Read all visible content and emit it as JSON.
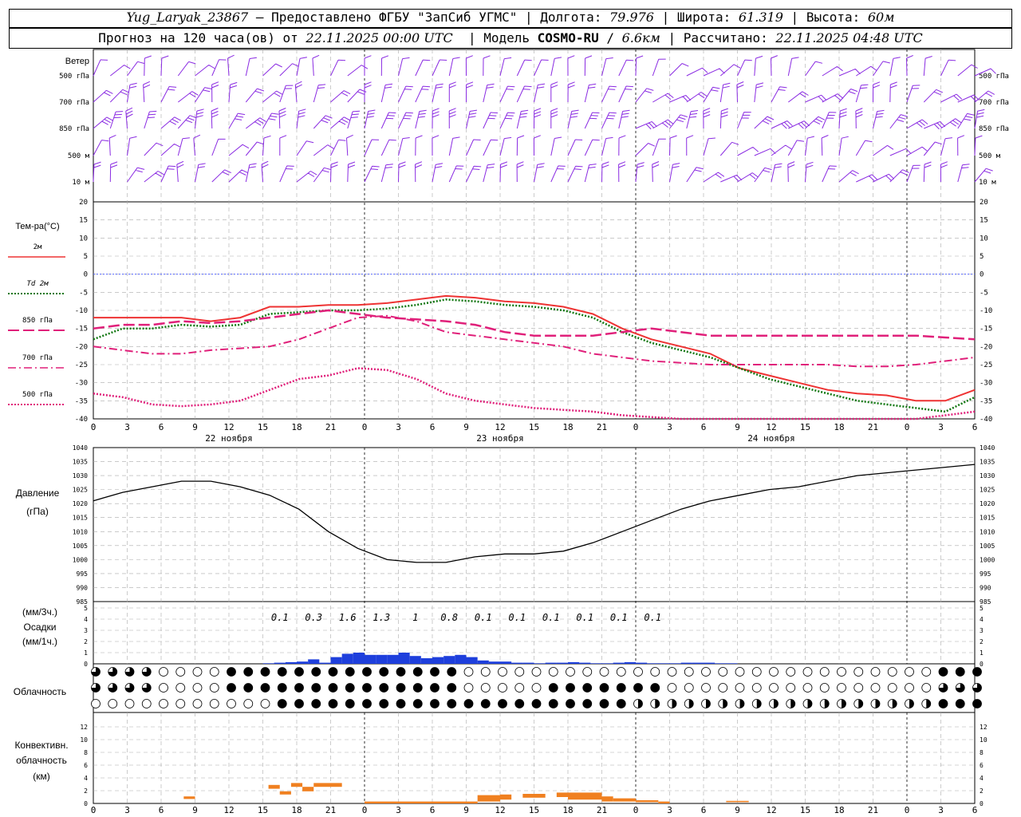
{
  "header": {
    "station": "Yug_Laryak_23867",
    "dash": " – ",
    "provider": "Предоставлено ФГБУ \"ЗапСиб УГМС\"",
    "lon_label": "Долгота: ",
    "lon_value": "79.976",
    "lat_label": "Широта: ",
    "lat_value": "61.319",
    "alt_label": "Высота: ",
    "alt_value": "60м",
    "forecast_label": "Прогноз на 120 часа(ов) от ",
    "forecast_time": "22.11.2025 00:00 UTC",
    "model_label": "Модель ",
    "model_name": "COSMO-RU",
    "model_res": "6.6км",
    "computed_label": "Рассчитано: ",
    "computed_time": "22.11.2025 04:48 UTC"
  },
  "colors": {
    "wind": "#8a2be2",
    "t2m": "#ee3333",
    "td2m": "#117711",
    "t850": "#e0207a",
    "t700": "#e0207a",
    "t500": "#e0207a",
    "zero_line": "#5566ff",
    "pressure": "#000000",
    "precip": "#1e3fdc",
    "convective": "#f08020",
    "grid": "#aaaaaa"
  },
  "wind_panel": {
    "title": "Ветер",
    "levels": [
      "500 гПа",
      "700 гПа",
      "850 гПа",
      "500 м",
      "10 м"
    ]
  },
  "temp_panel": {
    "title": "Тем-ра(°C)",
    "legend": [
      {
        "label": "2м",
        "key": "t2m",
        "dash": "solid"
      },
      {
        "label": "Td 2м",
        "key": "td2m",
        "dash": "dotted"
      },
      {
        "label": "850 гПа",
        "key": "t850",
        "dash": "long-dash"
      },
      {
        "label": "700 гПа",
        "key": "t700",
        "dash": "dash-dot"
      },
      {
        "label": "500 гПа",
        "key": "t500",
        "dash": "dotted"
      }
    ],
    "yticks": [
      "20",
      "15",
      "10",
      "5",
      "0",
      "-5",
      "-10",
      "-15",
      "-20",
      "-25",
      "-30",
      "-35",
      "-40"
    ]
  },
  "hour_ticks": [
    "0",
    "3",
    "6",
    "9",
    "12",
    "15",
    "18",
    "21",
    "0",
    "3",
    "6",
    "9",
    "12",
    "15",
    "18",
    "21",
    "0",
    "3",
    "6",
    "9",
    "12",
    "15",
    "18",
    "21",
    "0",
    "3",
    "6"
  ],
  "day_labels": [
    "22 ноября",
    "23 ноября",
    "24 ноября"
  ],
  "pressure_panel": {
    "title": "Давление",
    "unit": "(гПа)",
    "yticks": [
      "1040",
      "1035",
      "1030",
      "1025",
      "1020",
      "1015",
      "1010",
      "1005",
      "1000",
      "995",
      "990",
      "985"
    ]
  },
  "precip_panel": {
    "unit3": "(мм/3ч.)",
    "title": "Осадки",
    "unit1": "(мм/1ч.)",
    "yticks": [
      "5",
      "4",
      "3",
      "2",
      "1",
      "0"
    ],
    "labels3h": [
      "0.1",
      "0.3",
      "1.6",
      "1.3",
      "1",
      "0.8",
      "0.1",
      "0.1",
      "0.1",
      "0.1",
      "0.1",
      "0.1"
    ]
  },
  "cloud_panel": {
    "title": "Облачность"
  },
  "conv_panel": {
    "title1": "Конвективн.",
    "title2": "облачность",
    "unit": "(км)",
    "yticks": [
      "12",
      "10",
      "8",
      "6",
      "4",
      "2",
      "0"
    ]
  },
  "chart_data": [
    {
      "type": "line",
      "title": "Тем-ра(°C)",
      "x_hours": [
        0,
        3,
        6,
        9,
        12,
        15,
        18,
        21,
        24,
        27,
        30,
        33,
        36,
        39,
        42,
        45,
        48,
        51,
        54,
        57,
        60,
        63,
        66,
        69,
        72,
        75,
        78
      ],
      "ylim": [
        -40,
        20
      ],
      "series": [
        {
          "name": "2м",
          "values": [
            -12,
            -12,
            -12,
            -12,
            -13,
            -12,
            -9,
            -9,
            -8.5,
            -8.5,
            -8,
            -7,
            -6,
            -6.5,
            -7.5,
            -8,
            -9,
            -11,
            -15,
            -18,
            -20,
            -22,
            -26,
            -28,
            -30,
            -32,
            -33,
            -33.5,
            -35,
            -35,
            -32
          ]
        },
        {
          "name": "Td 2м",
          "values": [
            -18,
            -15,
            -15,
            -14,
            -14.5,
            -14,
            -11,
            -10.5,
            -10,
            -10,
            -9.5,
            -8.5,
            -7,
            -7.5,
            -8.5,
            -9,
            -10,
            -12,
            -16,
            -19,
            -21,
            -23,
            -26,
            -29,
            -31,
            -33,
            -35,
            -36,
            -37,
            -38,
            -34
          ]
        },
        {
          "name": "850 гПа",
          "values": [
            -15,
            -14,
            -14,
            -13,
            -13.5,
            -13,
            -12,
            -11,
            -10,
            -11,
            -12,
            -12.5,
            -13,
            -14,
            -16,
            -17,
            -17,
            -17,
            -16,
            -15,
            -16,
            -17,
            -17,
            -17,
            -17,
            -17,
            -17,
            -17,
            -17,
            -17.5,
            -18
          ]
        },
        {
          "name": "700 гПа",
          "values": [
            -20,
            -21,
            -22,
            -22,
            -21,
            -20.5,
            -20,
            -18,
            -15,
            -12,
            -11.5,
            -13,
            -16,
            -17,
            -18,
            -19,
            -20,
            -22,
            -23,
            -24,
            -24.5,
            -25,
            -25,
            -25,
            -25,
            -25,
            -25.5,
            -25.5,
            -25,
            -24,
            -23
          ]
        },
        {
          "name": "500 гПа",
          "values": [
            -33,
            -34,
            -36,
            -36.5,
            -36,
            -35,
            -32,
            -29,
            -28,
            -26,
            -26.5,
            -29,
            -33,
            -35,
            -36,
            -37,
            -37.5,
            -38,
            -39,
            -39.5,
            -40,
            -40,
            -40,
            -40,
            -40,
            -40,
            -40,
            -40,
            -40,
            -39,
            -38
          ]
        }
      ]
    },
    {
      "type": "line",
      "title": "Давление",
      "x_hours": [
        0,
        3,
        6,
        9,
        12,
        15,
        18,
        21,
        24,
        27,
        30,
        33,
        36,
        39,
        42,
        45,
        48,
        51,
        54,
        57,
        60,
        63,
        66,
        69,
        72,
        75,
        78
      ],
      "ylim": [
        985,
        1040
      ],
      "series": [
        {
          "name": "Давление",
          "values": [
            1021,
            1024,
            1026,
            1028,
            1028,
            1026,
            1023,
            1018,
            1010,
            1004,
            1000,
            999,
            999,
            1001,
            1002,
            1002,
            1003,
            1006,
            1010,
            1014,
            1018,
            1021,
            1023,
            1025,
            1026,
            1028,
            1030,
            1031,
            1032,
            1033,
            1034
          ]
        }
      ]
    },
    {
      "type": "bar",
      "title": "Осадки",
      "x_hours_1h": [
        15,
        16,
        17,
        18,
        19,
        20,
        21,
        22,
        23,
        24,
        25,
        26,
        27,
        28,
        29,
        30,
        31,
        32,
        33,
        34,
        35,
        36,
        37,
        38,
        39,
        40,
        41,
        42,
        43,
        44,
        45,
        46,
        47,
        48,
        49,
        50,
        51,
        52,
        53,
        54,
        55,
        56
      ],
      "values": [
        0.05,
        0.1,
        0.15,
        0.2,
        0.4,
        0.1,
        0.6,
        0.9,
        1.0,
        0.8,
        0.8,
        0.8,
        1.0,
        0.7,
        0.5,
        0.6,
        0.7,
        0.8,
        0.6,
        0.3,
        0.2,
        0.2,
        0.1,
        0.1,
        0.05,
        0.1,
        0.1,
        0.15,
        0.1,
        0.05,
        0.05,
        0.1,
        0.15,
        0.1,
        0.05,
        0.05,
        0.05,
        0.1,
        0.1,
        0.1,
        0.05,
        0.05
      ],
      "ylim": [
        0,
        5
      ]
    },
    {
      "type": "bar",
      "title": "Конвективн. облачность",
      "segments": [
        {
          "x0": 8.0,
          "x1": 9.0,
          "lo": 0.7,
          "hi": 1.1
        },
        {
          "x0": 15.5,
          "x1": 16.5,
          "lo": 2.3,
          "hi": 2.9
        },
        {
          "x0": 16.5,
          "x1": 17.5,
          "lo": 1.4,
          "hi": 1.9
        },
        {
          "x0": 17.5,
          "x1": 18.5,
          "lo": 2.6,
          "hi": 3.2
        },
        {
          "x0": 18.5,
          "x1": 19.5,
          "lo": 1.9,
          "hi": 2.6
        },
        {
          "x0": 19.5,
          "x1": 22.0,
          "lo": 2.6,
          "hi": 3.2
        },
        {
          "x0": 24.0,
          "x1": 34.0,
          "lo": 0.0,
          "hi": 0.3
        },
        {
          "x0": 34.0,
          "x1": 36.0,
          "lo": 0.3,
          "hi": 1.3
        },
        {
          "x0": 36.0,
          "x1": 37.0,
          "lo": 0.6,
          "hi": 1.4
        },
        {
          "x0": 38.0,
          "x1": 40.0,
          "lo": 0.9,
          "hi": 1.5
        },
        {
          "x0": 41.0,
          "x1": 42.0,
          "lo": 1.0,
          "hi": 1.7
        },
        {
          "x0": 42.0,
          "x1": 45.0,
          "lo": 0.6,
          "hi": 1.7
        },
        {
          "x0": 45.0,
          "x1": 46.0,
          "lo": 0.3,
          "hi": 1.1
        },
        {
          "x0": 46.0,
          "x1": 48.0,
          "lo": 0.3,
          "hi": 0.8
        },
        {
          "x0": 48.0,
          "x1": 50.0,
          "lo": 0.2,
          "hi": 0.5
        },
        {
          "x0": 50.0,
          "x1": 51.0,
          "lo": 0.0,
          "hi": 0.3
        },
        {
          "x0": 56.0,
          "x1": 58.0,
          "lo": 0.2,
          "hi": 0.4
        }
      ],
      "ylim": [
        0,
        13
      ]
    }
  ]
}
